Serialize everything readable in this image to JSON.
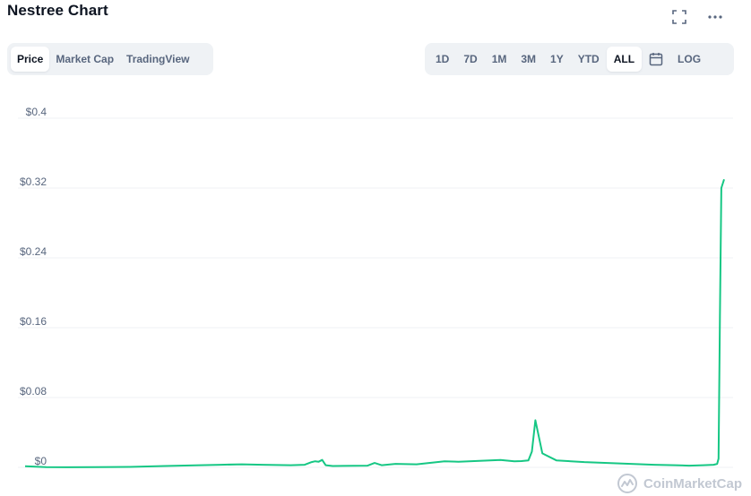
{
  "header": {
    "title": "Nestree Chart"
  },
  "icons": {
    "fullscreen": "fullscreen-icon",
    "more": "more-horizontal-icon",
    "calendar": "calendar-icon",
    "logo": "coinmarketcap-logo-icon"
  },
  "view_tabs": [
    {
      "label": "Price",
      "active": true
    },
    {
      "label": "Market Cap",
      "active": false
    },
    {
      "label": "TradingView",
      "active": false
    }
  ],
  "range_tabs": [
    {
      "label": "1D",
      "active": false
    },
    {
      "label": "7D",
      "active": false
    },
    {
      "label": "1M",
      "active": false
    },
    {
      "label": "3M",
      "active": false
    },
    {
      "label": "1Y",
      "active": false
    },
    {
      "label": "YTD",
      "active": false
    },
    {
      "label": "ALL",
      "active": true
    }
  ],
  "log_label": "LOG",
  "watermark": "CoinMarketCap",
  "colors": {
    "line": "#16c784",
    "grid": "#eff2f5",
    "axis_text": "#58667e",
    "watermark": "#c2c8d2"
  },
  "chart_data": {
    "type": "line",
    "y_ticks": [
      "$0.4",
      "$0.32",
      "$0.24",
      "$0.16",
      "$0.08",
      "$0"
    ],
    "ylim": [
      0,
      0.4
    ],
    "grid": true,
    "x": [
      0,
      0.03,
      0.06,
      0.1,
      0.15,
      0.2,
      0.25,
      0.28,
      0.31,
      0.34,
      0.38,
      0.4,
      0.405,
      0.41,
      0.415,
      0.42,
      0.425,
      0.43,
      0.44,
      0.47,
      0.49,
      0.5,
      0.51,
      0.53,
      0.56,
      0.6,
      0.62,
      0.65,
      0.68,
      0.7,
      0.71,
      0.72,
      0.725,
      0.73,
      0.74,
      0.76,
      0.8,
      0.85,
      0.9,
      0.93,
      0.95,
      0.97,
      0.985,
      0.99,
      0.992,
      0.994,
      0.996,
      1.0
    ],
    "values": [
      0.0012,
      0.0003,
      0.0001,
      0.0002,
      0.0005,
      0.0015,
      0.0025,
      0.003,
      0.0035,
      0.003,
      0.0025,
      0.003,
      0.0045,
      0.006,
      0.007,
      0.0065,
      0.0085,
      0.0025,
      0.0015,
      0.0018,
      0.002,
      0.005,
      0.0025,
      0.004,
      0.0035,
      0.007,
      0.0065,
      0.0075,
      0.0085,
      0.007,
      0.0072,
      0.008,
      0.018,
      0.054,
      0.016,
      0.008,
      0.006,
      0.0045,
      0.003,
      0.0025,
      0.002,
      0.0025,
      0.003,
      0.004,
      0.01,
      0.17,
      0.32,
      0.33
    ]
  }
}
